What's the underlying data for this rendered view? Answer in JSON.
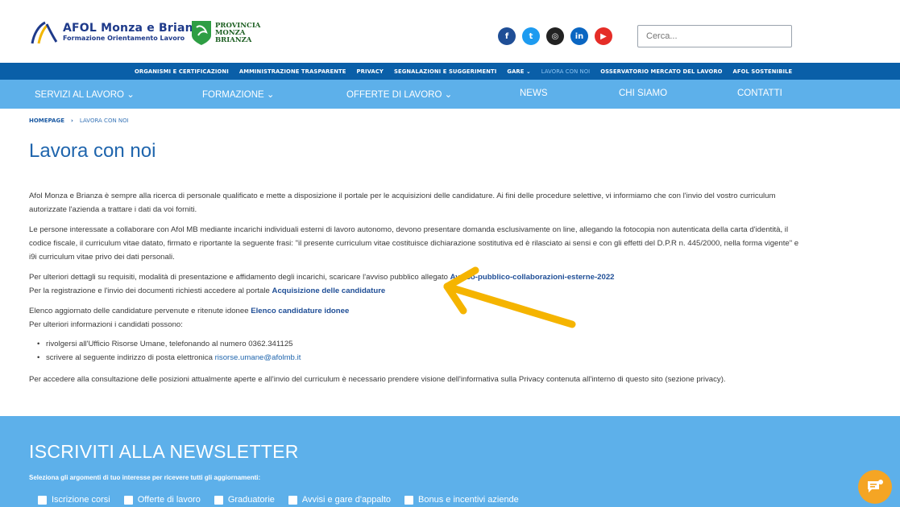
{
  "header": {
    "logo_title": "AFOL Monza e Brianza",
    "logo_subtitle": "Formazione Orientamento Lavoro",
    "province_logo": [
      "PROVINCIA",
      "MONZA",
      "BRIANZA"
    ],
    "socials": [
      {
        "name": "facebook-icon",
        "glyph": "f",
        "color": "#1f4e96"
      },
      {
        "name": "twitter-icon",
        "glyph": "t",
        "color": "#1d9bf0"
      },
      {
        "name": "instagram-icon",
        "glyph": "◎",
        "color": "#222222"
      },
      {
        "name": "linkedin-icon",
        "glyph": "in",
        "color": "#0a66c2"
      },
      {
        "name": "youtube-icon",
        "glyph": "▶",
        "color": "#e52d27"
      }
    ],
    "search_placeholder": "Cerca..."
  },
  "topnav": {
    "items": [
      "ORGANISMI E CERTIFICAZIONI",
      "AMMINISTRAZIONE TRASPARENTE",
      "PRIVACY",
      "SEGNALAZIONI E SUGGERIMENTI",
      "GARE",
      "LAVORA CON NOI",
      "OSSERVATORIO MERCATO DEL LAVORO",
      "AFOL SOSTENIBILE"
    ]
  },
  "mainnav": {
    "items": [
      "SERVIZI AL LAVORO",
      "FORMAZIONE",
      "OFFERTE DI LAVORO",
      "NEWS",
      "CHI SIAMO",
      "CONTATTI"
    ]
  },
  "breadcrumb": {
    "home": "HOMEPAGE",
    "sep": "›",
    "current": "LAVORA CON NOI"
  },
  "page": {
    "title": "Lavora con noi",
    "p1": "Afol Monza e Brianza è sempre alla ricerca di personale qualificato e mette a disposizione il portale per le acquisizioni delle candidature. Ai fini delle procedure selettive, vi informiamo che con l'invio del vostro curriculum autorizzate l'azienda a trattare i dati da voi forniti.",
    "p2": "Le persone interessate a collaborare con Afol MB mediante incarichi individuali esterni di lavoro autonomo, devono presentare domanda esclusivamente on line, allegando la fotocopia non autenticata della carta d'identità, il codice fiscale, il curriculum vitae datato, firmato e riportante la seguente frasi: \"il presente curriculum vitae costituisce dichiarazione sostitutiva ed è rilasciato ai sensi e con gli effetti del D.P.R n. 445/2000, nella forma vigente\" e i9i curriculum vitae privo dei dati personali.",
    "p3_text": "Per ulteriori dettagli su requisiti, modalità di presentazione e affidamento degli incarichi, scaricare l'avviso pubblico allegato ",
    "p3_link": "Avviso-pubblico-collaborazioni-esterne-2022",
    "p4_text": "Per la registrazione e l'invio dei documenti richiesti accedere al portale ",
    "p4_link": "Acquisizione delle candidature",
    "p5_text": "Elenco aggiornato delle candidature pervenute e ritenute idonee ",
    "p5_link": "Elenco candidature idonee",
    "p6": "Per ulteriori informazioni i candidati possono:",
    "bullet1": "rivolgersi all'Ufficio Risorse Umane, telefonando al numero 0362.341125",
    "bullet2_text": "scrivere al seguente indirizzo di posta elettronica ",
    "bullet2_link": "risorse.umane@afolmb.it",
    "p7": "Per accedere alla consultazione delle posizioni attualmente aperte e all'invio del curriculum è necessario prendere visione dell'informativa sulla Privacy contenuta all'interno di questo sito (sezione privacy)."
  },
  "newsletter": {
    "title": "ISCRIVITI ALLA NEWSLETTER",
    "subtitle": "Seleziona gli argomenti di tuo interesse per ricevere tutti gli aggiornamenti:",
    "options": [
      "Iscrizione corsi",
      "Offerte di lavoro",
      "Graduatorie",
      "Avvisi e gare d'appalto",
      "Bonus e incentivi aziende"
    ]
  },
  "colors": {
    "primary": "#0a5fa8",
    "light": "#5db0ea",
    "title": "#1f65ad",
    "arrow": "#f5b400",
    "chat": "#f5a524"
  }
}
